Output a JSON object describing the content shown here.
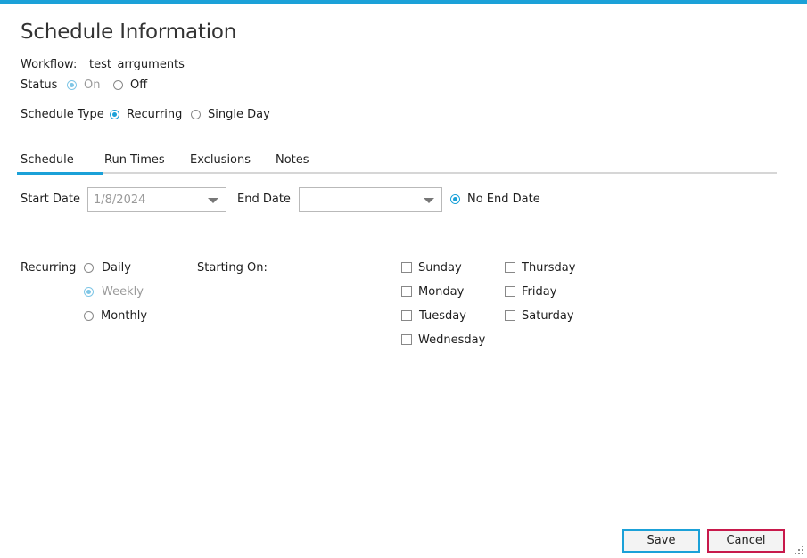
{
  "header": {
    "title": "Schedule Information"
  },
  "workflow": {
    "label": "Workflow:",
    "value": "test_arrguments"
  },
  "status": {
    "label": "Status",
    "on": "On",
    "off": "Off",
    "selected": "On"
  },
  "schedule_type": {
    "label": "Schedule Type",
    "recurring": "Recurring",
    "single_day": "Single Day",
    "selected": "Recurring"
  },
  "tabs": [
    "Schedule",
    "Run Times",
    "Exclusions",
    "Notes"
  ],
  "active_tab": "Schedule",
  "dates": {
    "start_label": "Start Date",
    "start_value": "1/8/2024",
    "end_label": "End Date",
    "end_value": "",
    "no_end_label": "No End Date"
  },
  "recurring": {
    "label": "Recurring",
    "options": [
      "Daily",
      "Weekly",
      "Monthly"
    ],
    "selected": "Weekly",
    "starting_on_label": "Starting On:"
  },
  "days": {
    "col1": [
      "Sunday",
      "Monday",
      "Tuesday",
      "Wednesday"
    ],
    "col2": [
      "Thursday",
      "Friday",
      "Saturday"
    ]
  },
  "footer": {
    "save": "Save",
    "cancel": "Cancel"
  },
  "colors": {
    "accent": "#1ba1d8",
    "cancel_border": "#c8194b"
  }
}
